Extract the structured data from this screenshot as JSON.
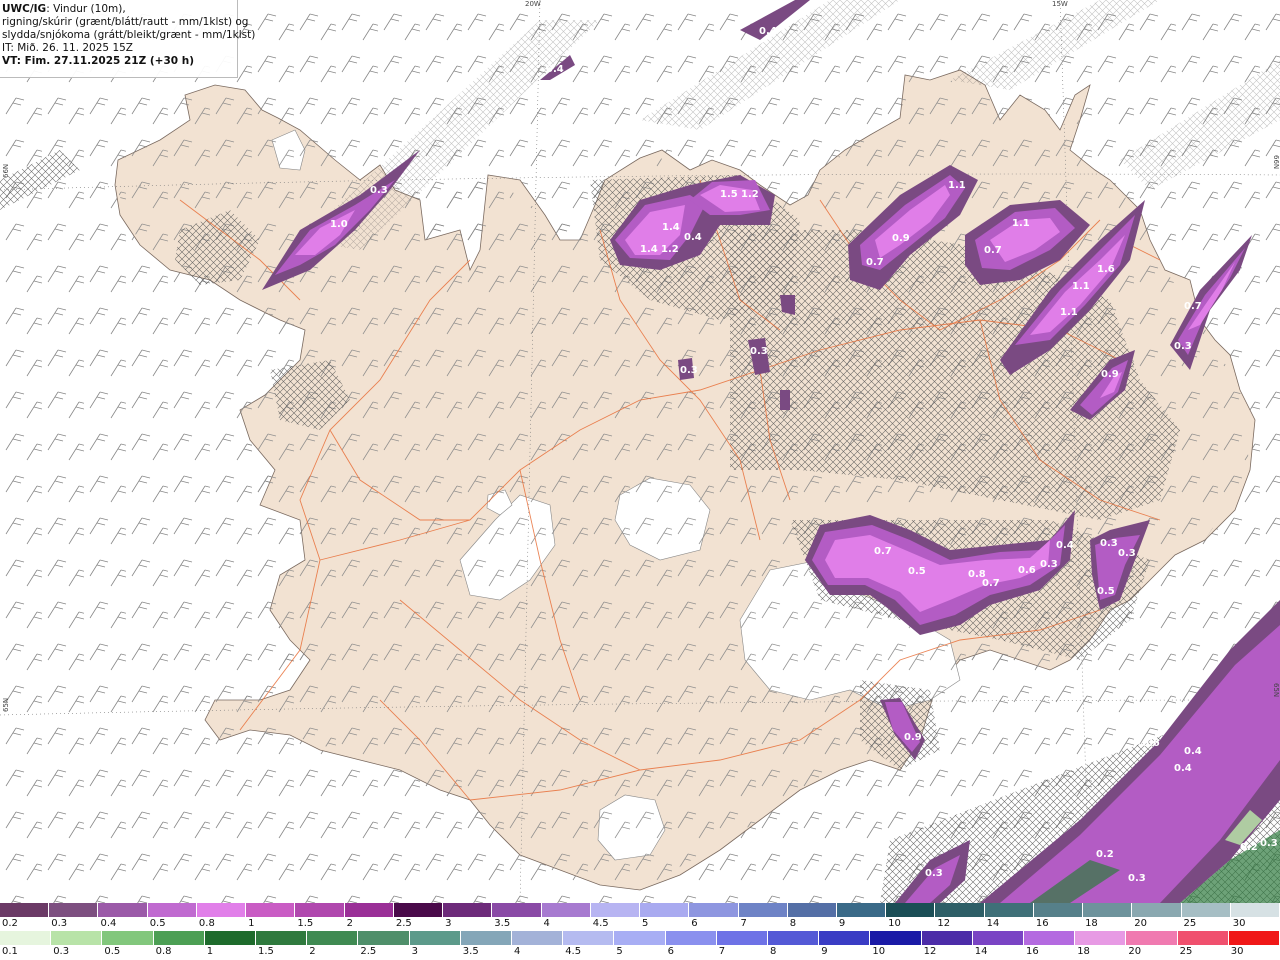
{
  "info": {
    "model": "UWC/IG",
    "line1_rest": ": Vindur (10m),",
    "line2": "rigning/skúrir (grænt/blátt/rautt - mm/1klst) og",
    "line3": "slydda/snjókoma (grátt/bleikt/grænt - mm/1klst)",
    "line4": "IT: Mið. 26. 11. 2025 15Z",
    "line5": "VT: Fim. 27.11.2025 21Z (+30 h)"
  },
  "coords": {
    "lon1": "20W",
    "lon2": "15W",
    "lat_left1": "66N",
    "lat_left2": "65N",
    "lat_right1": "66N",
    "lat_right2": "65N"
  },
  "colors": {
    "land": "#f2e2d2",
    "sea": "#ffffff",
    "roads": "#e8703a",
    "snow_light": "#7a4a82",
    "snow_mid": "#b35cc4",
    "snow_heavy": "#e07ee8"
  },
  "precip_labels": [
    {
      "text": "1.0"
    },
    {
      "text": "0.3"
    },
    {
      "text": "1.4"
    },
    {
      "text": "1.4"
    },
    {
      "text": "1.2"
    },
    {
      "text": "0.4"
    },
    {
      "text": "1.5"
    },
    {
      "text": "1.2"
    },
    {
      "text": "1.1"
    },
    {
      "text": "0.9"
    },
    {
      "text": "0.7"
    },
    {
      "text": "1.1"
    },
    {
      "text": "0.7"
    },
    {
      "text": "1.6"
    },
    {
      "text": "1.1"
    },
    {
      "text": "1.1"
    },
    {
      "text": "0.7"
    },
    {
      "text": "0.3"
    },
    {
      "text": "0.9"
    },
    {
      "text": "0.3"
    },
    {
      "text": "0.3"
    },
    {
      "text": "0.3"
    },
    {
      "text": "0.7"
    },
    {
      "text": "0.5"
    },
    {
      "text": "0.8"
    },
    {
      "text": "0.7"
    },
    {
      "text": "0.6"
    },
    {
      "text": "0.4"
    },
    {
      "text": "0.3"
    },
    {
      "text": "0.3"
    },
    {
      "text": "0.5"
    },
    {
      "text": "0.6"
    },
    {
      "text": "0.4"
    },
    {
      "text": "0.4"
    },
    {
      "text": "0.2"
    },
    {
      "text": "0.3"
    },
    {
      "text": "0.3"
    },
    {
      "text": "0.2"
    },
    {
      "text": "0.3"
    },
    {
      "text": "0.4"
    },
    {
      "text": "0.9"
    },
    {
      "text": "0.4"
    }
  ],
  "legend_top": {
    "labels": [
      "0.2",
      "0.3",
      "0.4",
      "0.5",
      "0.8",
      "1",
      "1.5",
      "2",
      "2.5",
      "3",
      "3.5",
      "4",
      "4.5",
      "5",
      "6",
      "7",
      "8",
      "9",
      "10",
      "12",
      "14",
      "16",
      "18",
      "20",
      "25",
      "30"
    ],
    "colors": [
      "#6b3a66",
      "#7d4f80",
      "#9b5aa8",
      "#c06ad0",
      "#e17fe9",
      "#c95cc4",
      "#b048ae",
      "#9a2f97",
      "#4a0a4a",
      "#6d2a7a",
      "#8a4aa6",
      "#a77ad0",
      "#b7b4f2",
      "#a9aaf0",
      "#8e96e0",
      "#6e83c6",
      "#546fa6",
      "#3a6a88",
      "#1b4e56",
      "#2d5e66",
      "#3f7078",
      "#56808a",
      "#6e939c",
      "#8aa8b0",
      "#a6bec4",
      "#d6e1e4"
    ]
  },
  "legend_bottom": {
    "labels": [
      "0.1",
      "0.3",
      "0.5",
      "0.8",
      "1",
      "1.5",
      "2",
      "2.5",
      "3",
      "3.5",
      "4",
      "4.5",
      "5",
      "6",
      "7",
      "8",
      "9",
      "10",
      "12",
      "14",
      "16",
      "18",
      "20",
      "25",
      "30"
    ],
    "colors": [
      "#e6f5de",
      "#b8e3a8",
      "#82c77c",
      "#4c9f54",
      "#1e6b2c",
      "#2f7a3e",
      "#3f8a52",
      "#4f8f6a",
      "#5c9a8a",
      "#84a6b8",
      "#a3b2d8",
      "#b5bbf0",
      "#a8aef4",
      "#8a90ee",
      "#6e72e6",
      "#5459d6",
      "#3a3cc4",
      "#1a1aa6",
      "#4c2ca8",
      "#7a44c4",
      "#b46ae0",
      "#e79ae4",
      "#f07ab0",
      "#f0506e",
      "#f01818"
    ]
  }
}
